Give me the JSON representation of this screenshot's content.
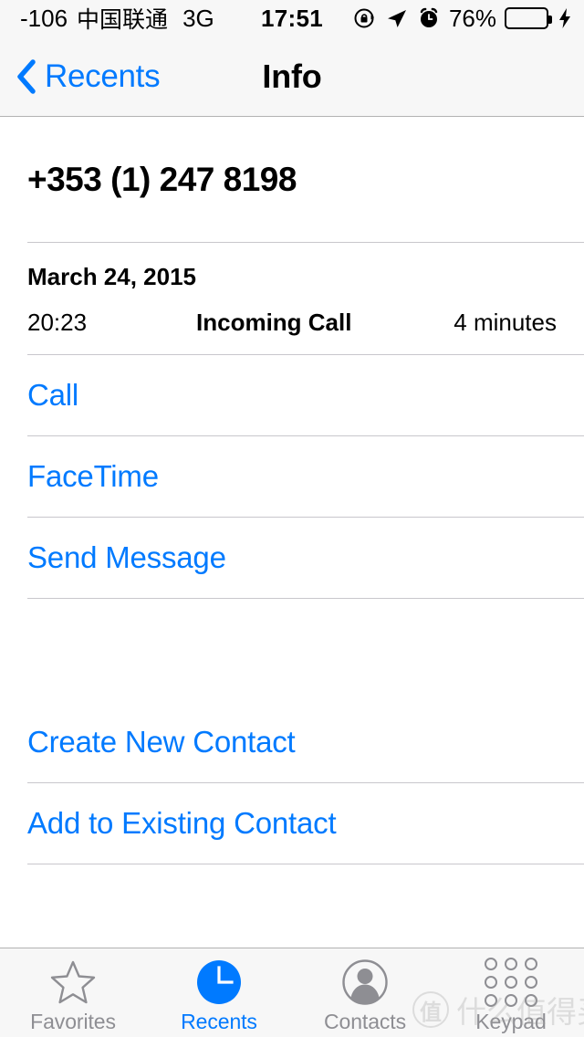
{
  "status_bar": {
    "signal_strength": "-106",
    "carrier": "中国联通",
    "network_type": "3G",
    "time": "17:51",
    "battery_percent": "76%",
    "battery_level": 76,
    "icons": [
      "rotation-lock-icon",
      "location-arrow-icon",
      "alarm-clock-icon",
      "battery-icon",
      "charging-bolt-icon"
    ]
  },
  "nav_bar": {
    "back_label": "Recents",
    "title": "Info",
    "back_icon": "chevron-left-icon"
  },
  "contact": {
    "phone_number": "+353 (1) 247 8198"
  },
  "call_log": {
    "date": "March 24, 2015",
    "entries": [
      {
        "time": "20:23",
        "type": "Incoming Call",
        "duration": "4 minutes"
      }
    ]
  },
  "actions_primary": [
    {
      "label": "Call",
      "name": "call"
    },
    {
      "label": "FaceTime",
      "name": "facetime"
    },
    {
      "label": "Send Message",
      "name": "send-message"
    }
  ],
  "actions_secondary": [
    {
      "label": "Create New Contact",
      "name": "create-new-contact"
    },
    {
      "label": "Add to Existing Contact",
      "name": "add-to-existing-contact"
    }
  ],
  "tab_bar": {
    "tabs": [
      {
        "label": "Favorites",
        "icon": "star-outline-icon",
        "active": false
      },
      {
        "label": "Recents",
        "icon": "clock-filled-icon",
        "active": true
      },
      {
        "label": "Contacts",
        "icon": "person-circle-icon",
        "active": false
      },
      {
        "label": "Keypad",
        "icon": "keypad-dots-icon",
        "active": false
      }
    ]
  },
  "watermark": {
    "badge": "值",
    "text": "什么值得买"
  },
  "colors": {
    "accent_blue": "#007aff",
    "battery_green": "#4cd964",
    "inactive_gray": "#8e8e93",
    "separator": "#c8c7cc",
    "bar_background": "#f7f7f7"
  }
}
